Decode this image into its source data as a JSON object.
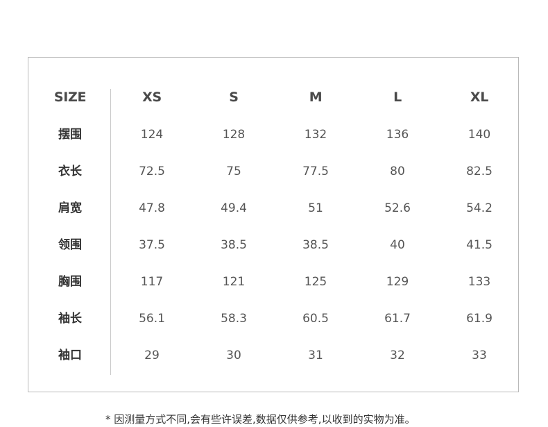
{
  "table": {
    "corner_header": "SIZE",
    "columns": [
      "XS",
      "S",
      "M",
      "L",
      "XL"
    ],
    "rows": [
      {
        "label": "摆围",
        "values": [
          "124",
          "128",
          "132",
          "136",
          "140"
        ]
      },
      {
        "label": "衣长",
        "values": [
          "72.5",
          "75",
          "77.5",
          "80",
          "82.5"
        ]
      },
      {
        "label": "肩宽",
        "values": [
          "47.8",
          "49.4",
          "51",
          "52.6",
          "54.2"
        ]
      },
      {
        "label": "领围",
        "values": [
          "37.5",
          "38.5",
          "38.5",
          "40",
          "41.5"
        ]
      },
      {
        "label": "胸围",
        "values": [
          "117",
          "121",
          "125",
          "129",
          "133"
        ]
      },
      {
        "label": "袖长",
        "values": [
          "56.1",
          "58.3",
          "60.5",
          "61.7",
          "61.9"
        ]
      },
      {
        "label": "袖口",
        "values": [
          "29",
          "30",
          "31",
          "32",
          "33"
        ]
      }
    ]
  },
  "footnote": "* 因测量方式不同,会有些许误差,数据仅供参考,以收到的实物为准。"
}
